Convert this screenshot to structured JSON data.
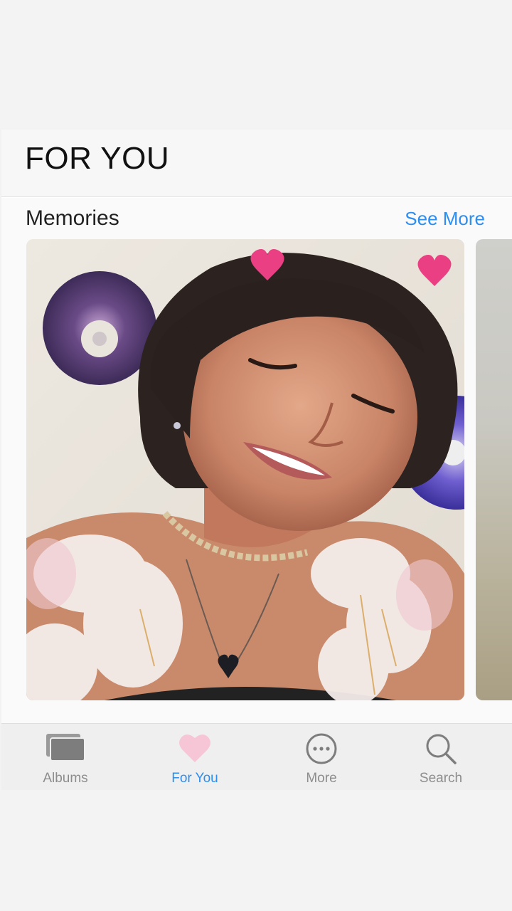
{
  "header": {
    "title": "FOR YOU"
  },
  "memories": {
    "section_title": "Memories",
    "see_more_label": "See More",
    "cards": [
      {
        "description": "selfie-photo"
      }
    ]
  },
  "tabbar": {
    "tabs": [
      {
        "label": "Albums",
        "icon": "albums-icon",
        "active": false
      },
      {
        "label": "For You",
        "icon": "heart-icon",
        "active": true
      },
      {
        "label": "More",
        "icon": "more-icon",
        "active": false
      },
      {
        "label": "Search",
        "icon": "search-icon",
        "active": false
      }
    ]
  },
  "colors": {
    "accent": "#2d8ef0",
    "heart": "#f7c6d6",
    "inactive": "#8d8d8d"
  }
}
